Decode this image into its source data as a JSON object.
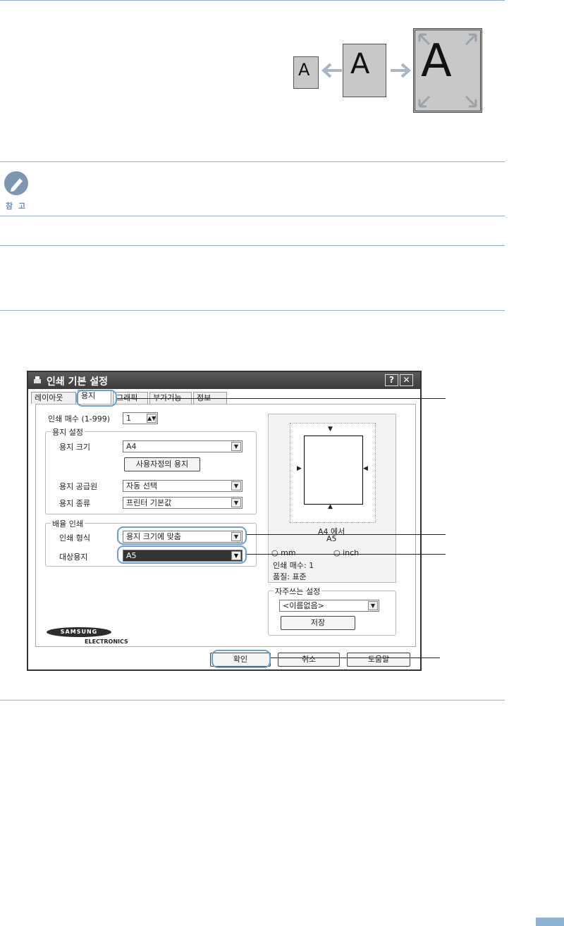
{
  "illustration": {
    "letter": "A"
  },
  "note": {
    "label": "참 고"
  },
  "dialog": {
    "title": "인쇄 기본 설정",
    "help_button": "?",
    "close_button": "✕",
    "tabs": [
      "레이아웃",
      "용지",
      "그래픽",
      "부가기능",
      "정보"
    ],
    "copies": {
      "label": "인쇄 매수 (1-999)",
      "value": "1"
    },
    "paper_group": {
      "title": "용지 설정",
      "size_label": "용지 크기",
      "size_value": "A4",
      "custom_button": "사용자정의 용지",
      "source_label": "용지 공급원",
      "source_value": "자동 선택",
      "type_label": "용지 종류",
      "type_value": "프린터 기본값"
    },
    "scale_group": {
      "title": "배율 인쇄",
      "mode_label": "인쇄 형식",
      "mode_value": "용지 크기에 맞춤",
      "target_label": "대상용지",
      "target_value": "A5"
    },
    "preview": {
      "caption_line1": "A4 에서",
      "caption_line2": "A5",
      "radio1": "mm",
      "radio2": "inch",
      "copies_info": "인쇄 매수: 1",
      "quality_info": "품질: 표준"
    },
    "favorites": {
      "title": "자주쓰는 설정",
      "value": "<이름없음>",
      "save_button": "저장"
    },
    "brand": {
      "name": "SAMSUNG",
      "sub": "ELECTRONICS"
    },
    "ok_button": "확인",
    "cancel_button": "취소",
    "help_footer_button": "도움말"
  },
  "colors": {
    "accent": "#8fb2d4",
    "callout": "#6aa0d6"
  }
}
